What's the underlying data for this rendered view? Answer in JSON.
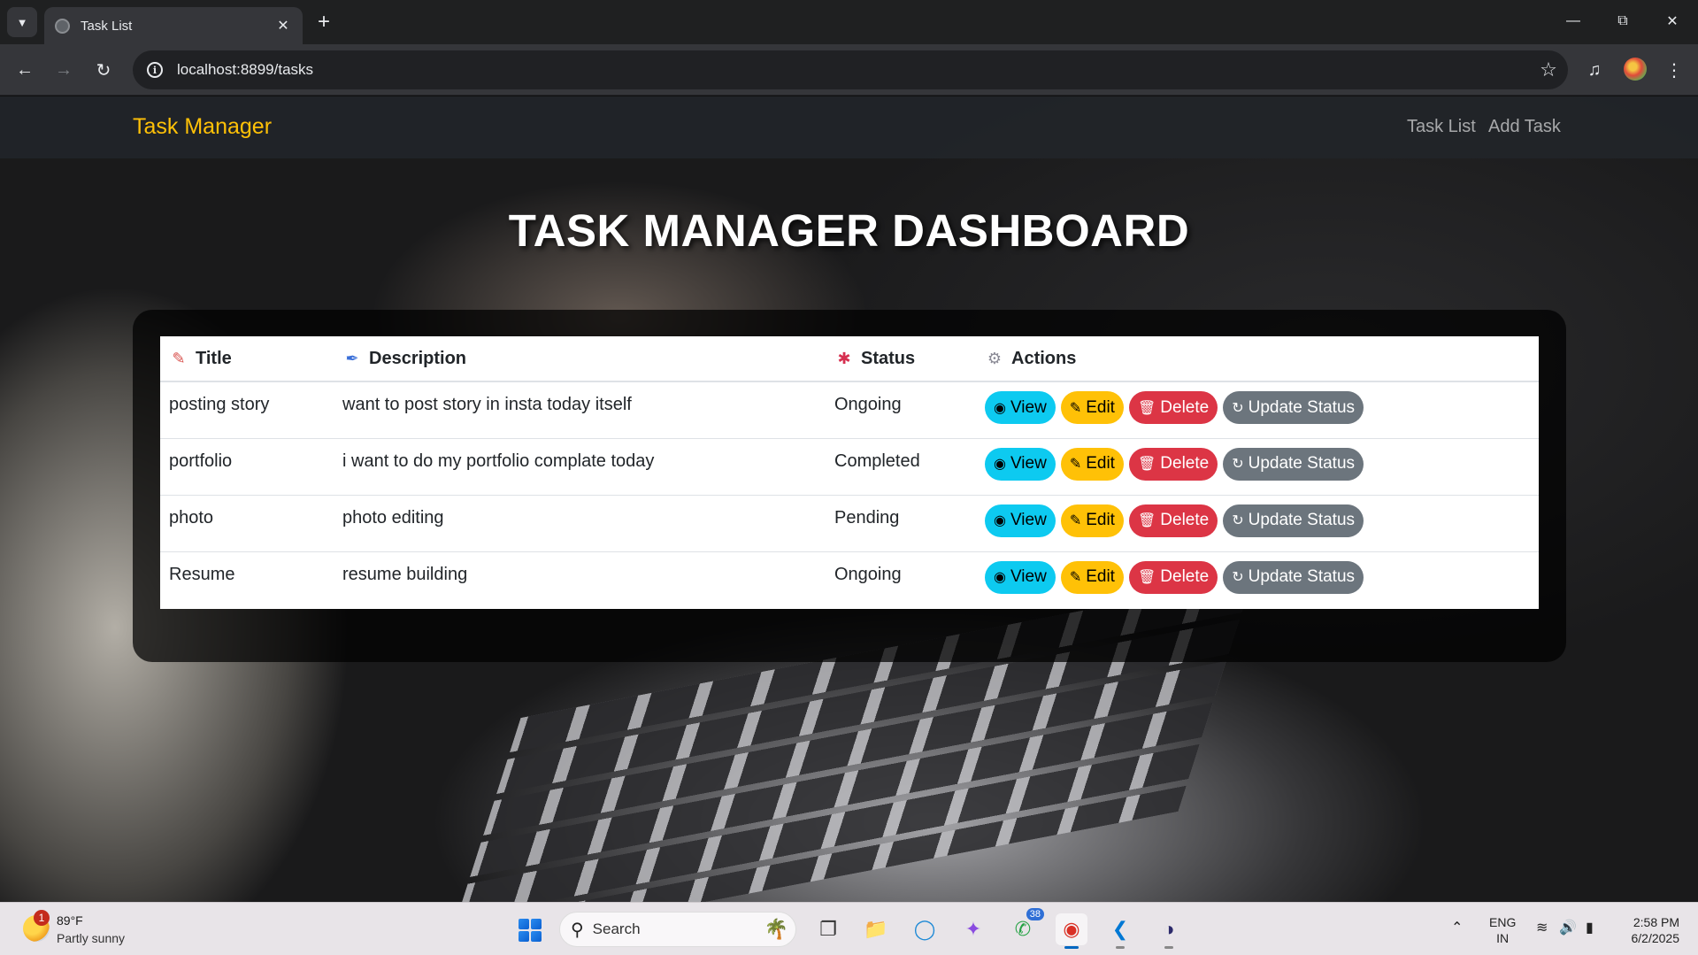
{
  "browser": {
    "tab_title": "Task List",
    "url": "localhost:8899/tasks"
  },
  "app": {
    "brand": "Task Manager",
    "nav": [
      "Task List",
      "Add Task"
    ],
    "heading": "TASK MANAGER DASHBOARD"
  },
  "table": {
    "columns": [
      {
        "label": "Title",
        "icon": "memo-icon"
      },
      {
        "label": "Description",
        "icon": "paintbrush-icon"
      },
      {
        "label": "Status",
        "icon": "pushpin-icon"
      },
      {
        "label": "Actions",
        "icon": "gear-icon"
      }
    ],
    "rows": [
      {
        "title": "posting story",
        "description": "want to post story in insta today itself",
        "status": "Ongoing"
      },
      {
        "title": "portfolio",
        "description": "i want to do my portfolio complate today",
        "status": "Completed"
      },
      {
        "title": "photo",
        "description": "photo editing",
        "status": "Pending"
      },
      {
        "title": "Resume",
        "description": "resume building",
        "status": "Ongoing"
      }
    ],
    "actions": {
      "view": "View",
      "edit": "Edit",
      "delete": "Delete",
      "update": "Update Status"
    }
  },
  "taskbar": {
    "weather_temp": "89°F",
    "weather_desc": "Partly sunny",
    "weather_badge": "1",
    "search_placeholder": "Search",
    "whatsapp_badge": "38",
    "lang_line1": "ENG",
    "lang_line2": "IN",
    "time": "2:58 PM",
    "date": "6/2/2025"
  },
  "colors": {
    "brand": "#ffc107",
    "view": "#0dcaf0",
    "edit": "#ffc107",
    "delete": "#dc3545",
    "update": "#6c757d"
  }
}
